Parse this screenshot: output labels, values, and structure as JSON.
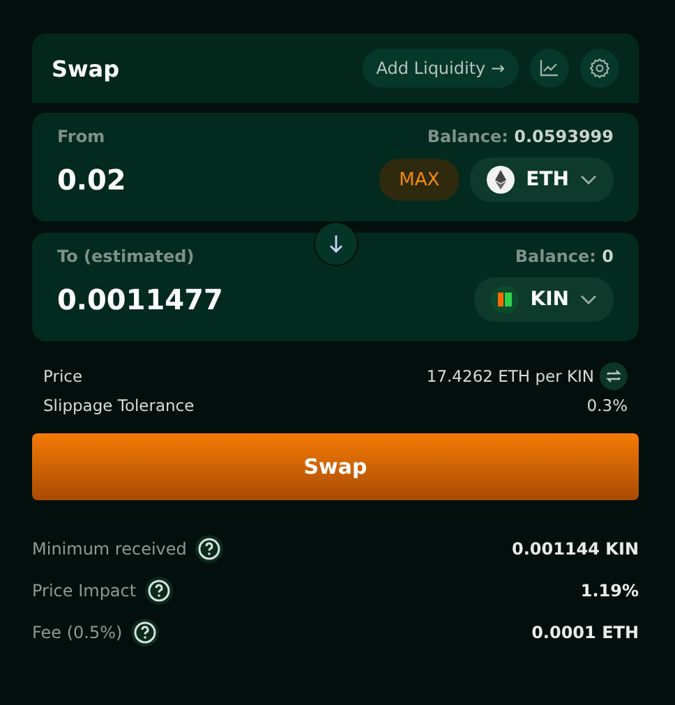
{
  "header": {
    "title": "Swap",
    "add_liquidity": "Add Liquidity →"
  },
  "from": {
    "label": "From",
    "balance_label": "Balance:",
    "balance": "0.0593999",
    "amount": "0.02",
    "max": "MAX",
    "token": "ETH",
    "kind": "eth"
  },
  "to": {
    "label": "To (estimated)",
    "balance_label": "Balance:",
    "balance": "0",
    "amount": "0.0011477",
    "token": "KIN",
    "kind": "kin"
  },
  "summary": [
    {
      "label": "Price",
      "value": "17.4262 ETH per KIN",
      "kind": "swap"
    },
    {
      "label": "Slippage Tolerance",
      "value": "0.3%",
      "kind": "plain"
    }
  ],
  "swap_button": "Swap",
  "details": [
    {
      "label": "Minimum received",
      "value": "0.001144 KIN"
    },
    {
      "label": "Price Impact",
      "value": "1.19%"
    },
    {
      "label": "Fee (0.5%)",
      "value": "0.0001 ETH"
    }
  ]
}
